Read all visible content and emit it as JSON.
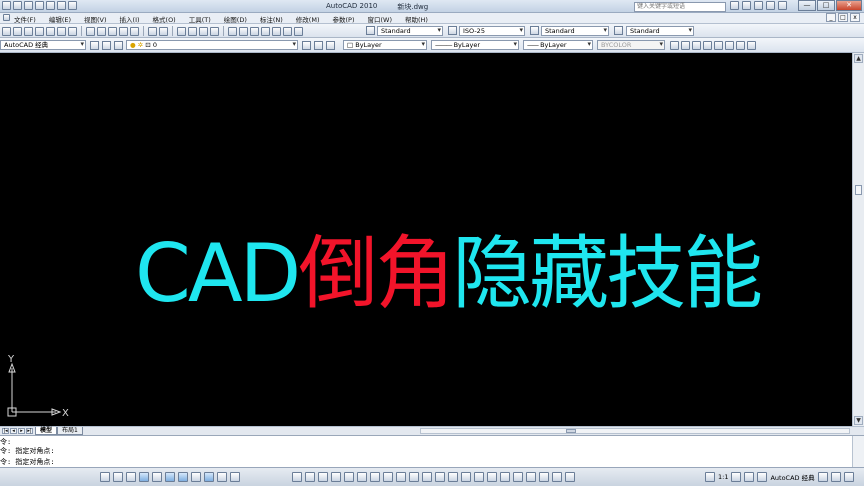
{
  "window": {
    "app_title": "AutoCAD 2010",
    "document_title": "新块.dwg",
    "search_placeholder": "键入关键字或短语",
    "minimize": "—",
    "maximize": "□",
    "close": "✕"
  },
  "menu": {
    "items": [
      "文件(F)",
      "编辑(E)",
      "视图(V)",
      "插入(I)",
      "格式(O)",
      "工具(T)",
      "绘图(D)",
      "标注(N)",
      "修改(M)",
      "参数(P)",
      "窗口(W)",
      "帮助(H)"
    ],
    "mdi_min": "_",
    "mdi_max": "□",
    "mdi_close": "x"
  },
  "toolbar1": {
    "text_style": "Standard",
    "dim_style": "ISO-25",
    "table_style": "Standard",
    "mleader_style": "Standard"
  },
  "toolbar2": {
    "workspace": "AutoCAD 经典",
    "layer": "0",
    "color": "ByLayer",
    "linetype": "ByLayer",
    "lineweight": "ByLayer",
    "plotstyle": "BYCOLOR"
  },
  "canvas": {
    "part1": "CAD",
    "part2": "倒角",
    "part3": "隐藏技能",
    "color_cyan": "#1fe6ef",
    "color_red": "#f2142a",
    "ucs_y": "Y",
    "ucs_x": "X"
  },
  "layout": {
    "tab_model": "模型",
    "tab_layout1": "布局1"
  },
  "command": {
    "lines": [
      "令:",
      "令: 指定对角点:",
      "令: 指定对角点:"
    ]
  },
  "status": {
    "scale": "1:1",
    "workspace": "AutoCAD 经典"
  }
}
